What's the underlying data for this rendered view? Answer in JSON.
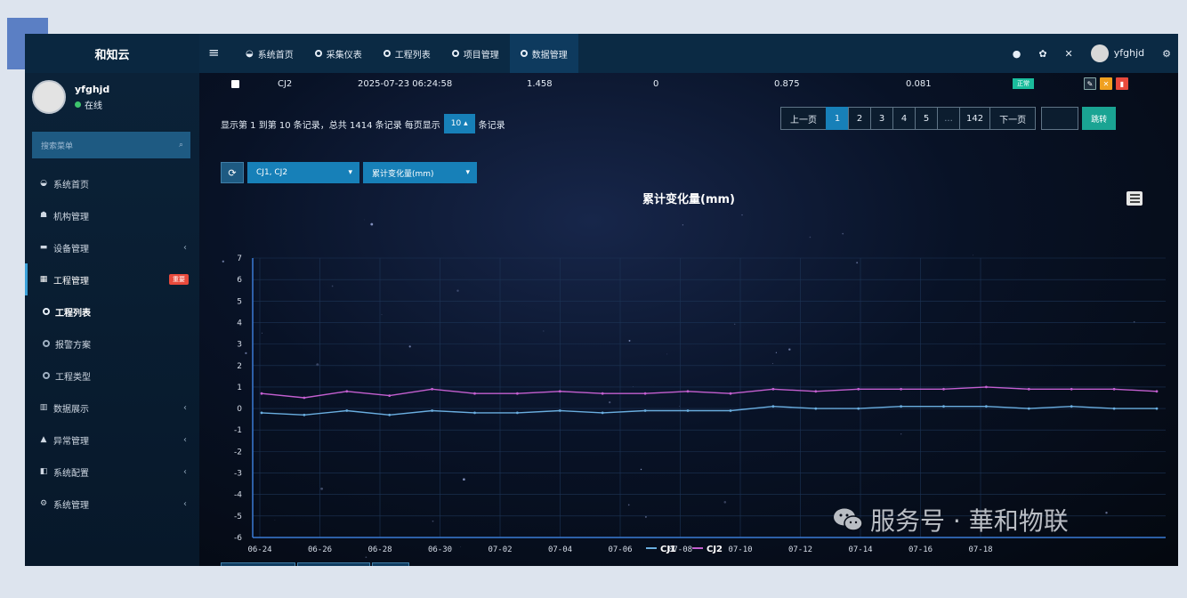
{
  "header": {
    "brand": "和知云",
    "nav": [
      {
        "label": "系统首页",
        "icon": "dashboard-icon"
      },
      {
        "label": "采集仪表",
        "icon": "circle-icon"
      },
      {
        "label": "工程列表",
        "icon": "circle-icon"
      },
      {
        "label": "项目管理",
        "icon": "circle-icon"
      },
      {
        "label": "数据管理",
        "icon": "circle-icon"
      }
    ],
    "username": "yfghjd"
  },
  "sidebar": {
    "username": "yfghjd",
    "status": "在线",
    "search_placeholder": "搜索菜单",
    "items": [
      {
        "label": "系统首页"
      },
      {
        "label": "机构管理"
      },
      {
        "label": "设备管理"
      },
      {
        "label": "工程管理",
        "badge": "重要"
      },
      {
        "label": "工程列表"
      },
      {
        "label": "报警方案"
      },
      {
        "label": "工程类型"
      },
      {
        "label": "数据展示"
      },
      {
        "label": "异常管理"
      },
      {
        "label": "系统配置"
      },
      {
        "label": "系统管理"
      }
    ]
  },
  "table_row": {
    "point": "CJ2",
    "time": "2025-07-23 06:24:58",
    "v1": "1.458",
    "v2": "0",
    "v3": "0.875",
    "v4": "0.081",
    "status": "正常"
  },
  "pagination": {
    "info_prefix": "显示第 1 到第 10 条记录，总共 1414 条记录 每页显示",
    "page_size": "10",
    "info_suffix": "条记录",
    "prev": "上一页",
    "pages": [
      "1",
      "2",
      "3",
      "4",
      "5",
      "...",
      "142"
    ],
    "next": "下一页",
    "go": "跳转"
  },
  "toolbar": {
    "points": "CJ1, CJ2",
    "metric": "累计变化量(mm)"
  },
  "watermark": "服务号 · 華和物联",
  "colors": {
    "accent": "#1780b8",
    "cj1": "#6aaee0",
    "cj2": "#c45fd0",
    "axis": "#3a7bd5"
  },
  "chart_data": {
    "type": "line",
    "title": "累计变化量(mm)",
    "ylim": [
      -6,
      7
    ],
    "yticks": [
      7,
      6,
      5,
      4,
      3,
      2,
      1,
      0,
      -1,
      -2,
      -3,
      -4,
      -5,
      -6
    ],
    "xticks": [
      "06-24",
      "06-26",
      "06-28",
      "06-30",
      "07-02",
      "07-04",
      "07-06",
      "07-08",
      "07-10",
      "07-12",
      "07-14",
      "07-16",
      "07-18"
    ],
    "series": [
      {
        "name": "CJ1",
        "values": [
          -0.2,
          -0.3,
          -0.1,
          -0.3,
          -0.1,
          -0.2,
          -0.2,
          -0.1,
          -0.2,
          -0.1,
          -0.1,
          -0.1,
          0.1,
          0.0,
          0.0,
          0.1,
          0.1,
          0.1,
          0.0,
          0.1,
          0.0,
          0.0
        ]
      },
      {
        "name": "CJ2",
        "values": [
          0.7,
          0.5,
          0.8,
          0.6,
          0.9,
          0.7,
          0.7,
          0.8,
          0.7,
          0.7,
          0.8,
          0.7,
          0.9,
          0.8,
          0.9,
          0.9,
          0.9,
          1.0,
          0.9,
          0.9,
          0.9,
          0.8
        ]
      }
    ],
    "legend": "bottom-center",
    "grid": true
  }
}
